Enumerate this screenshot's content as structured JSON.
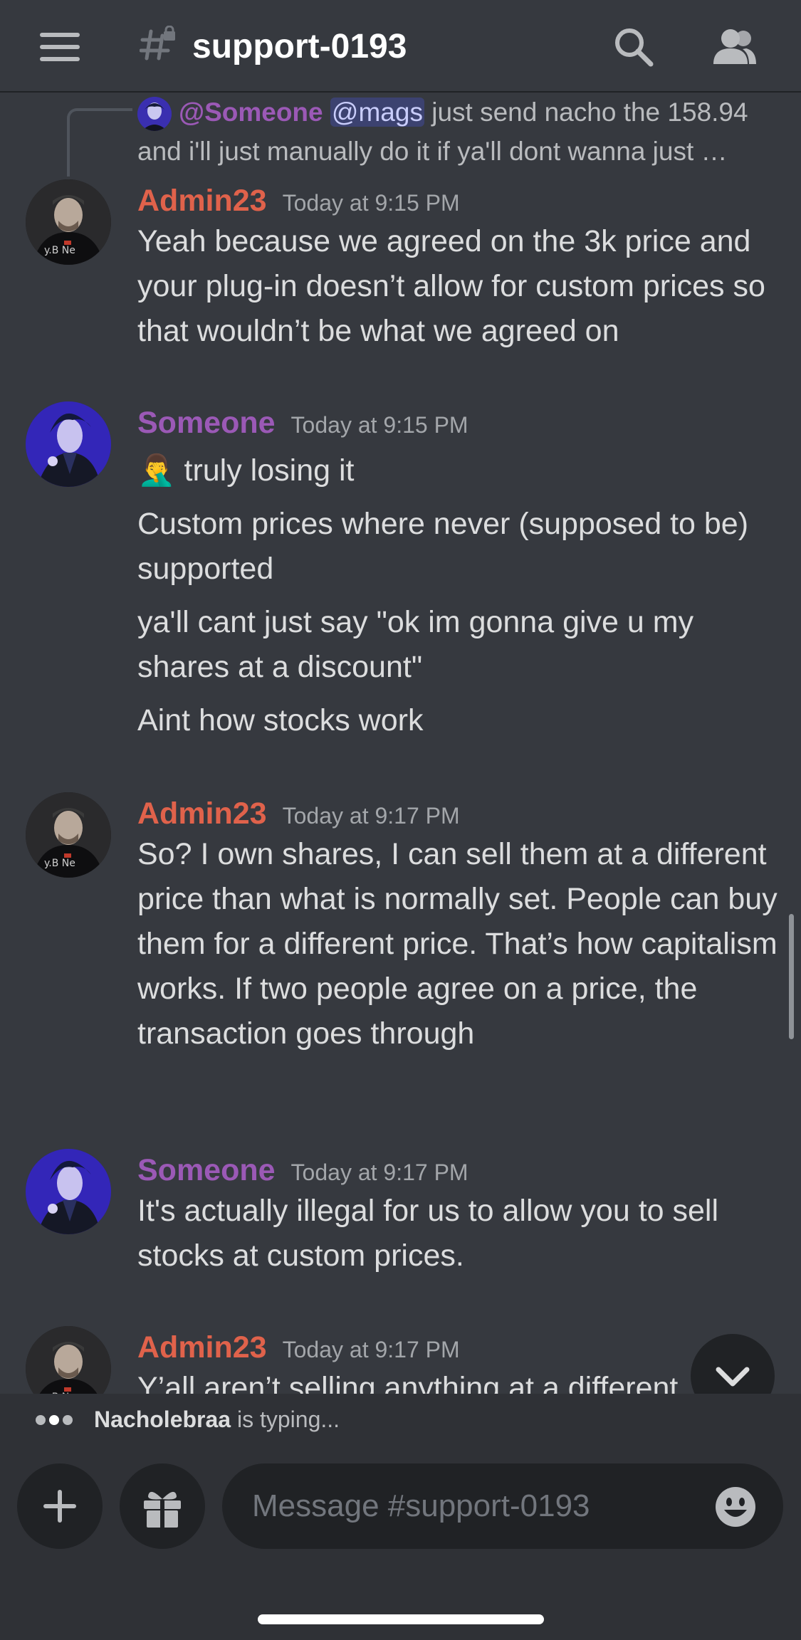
{
  "header": {
    "channel_name": "support-0193"
  },
  "reply_preview": {
    "author": "@Someone",
    "mention": "@mags",
    "text_line1": " just send nacho the 158.94",
    "text_line2": "and i'll just manually do it if ya'll dont wanna just …"
  },
  "messages": [
    {
      "author": "Admin23",
      "time": "Today at 9:15 PM",
      "lines": [
        "Yeah because we agreed on the 3k price and your plug-in doesn’t allow for custom prices so that wouldn’t be what we agreed on"
      ]
    },
    {
      "author": "Someone",
      "time": "Today at 9:15 PM",
      "emoji": "🤦‍♂️",
      "lines": [
        "truly losing it",
        "Custom prices where never (supposed to be) supported",
        "ya'll cant just say \"ok im gonna give u my shares at a discount\"",
        "Aint how stocks work"
      ]
    },
    {
      "author": "Admin23",
      "time": "Today at 9:17 PM",
      "lines": [
        "So? I own shares, I can sell them at a different price than what is normally set. People can buy them for a different price. That’s how capitalism works. If two people agree on a price, the transaction goes through"
      ]
    },
    {
      "author": "Someone",
      "time": "Today at 9:17 PM",
      "lines": [
        "It's actually illegal for us to allow you to sell stocks at custom prices."
      ]
    },
    {
      "author": "Admin23",
      "time": "Today at 9:17 PM",
      "lines": [
        "Y’all aren’t selling anything at a different"
      ]
    }
  ],
  "typing": {
    "user": "Nacholebraa",
    "suffix": " is typing..."
  },
  "composer": {
    "placeholder": "Message #support-0193"
  },
  "icons": {
    "menu": "hamburger-menu-icon",
    "channel": "locked-text-channel-icon",
    "search": "search-icon",
    "members": "members-icon",
    "add": "plus-icon",
    "gift": "gift-icon",
    "emoji": "emoji-icon",
    "jump": "chevron-down-icon"
  },
  "colors": {
    "admin_name": "#e0624b",
    "someone_name": "#9b59b6",
    "background": "#36393f"
  }
}
